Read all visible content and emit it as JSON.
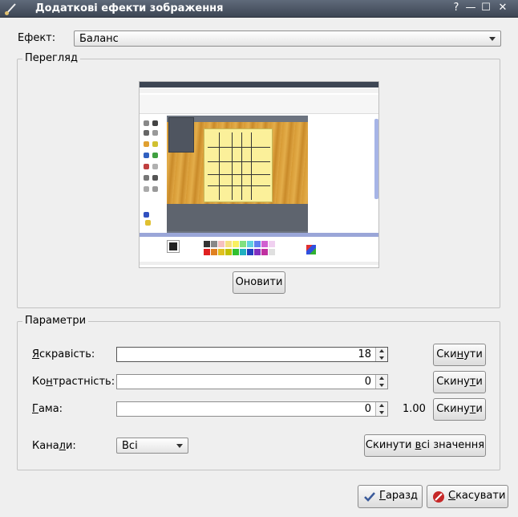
{
  "window": {
    "title": "Додаткові ефекти зображення",
    "buttons": {
      "help": "?",
      "minimize": "—",
      "maximize": "☐",
      "close": "✕"
    }
  },
  "effect": {
    "label": "Ефект:",
    "value": "Баланс"
  },
  "preview": {
    "group_title": "Перегляд",
    "update_button": "Оновити"
  },
  "params": {
    "group_title": "Параметри",
    "rows": [
      {
        "label_ul": "Я",
        "label_rest": "скравість:",
        "value": "18",
        "reset_pre": "Ски",
        "reset_ul": "н",
        "reset_post": "ути"
      },
      {
        "label_pre": "Ко",
        "label_ul": "н",
        "label_rest": "трастність:",
        "value": "0",
        "reset_pre": "Скину",
        "reset_ul": "т",
        "reset_post": "и"
      },
      {
        "label_ul": "Г",
        "label_rest": "ама:",
        "value": "0",
        "extra": "1.00",
        "reset_pre": "Скину",
        "reset_ul": "т",
        "reset_post": "и"
      }
    ],
    "channels": {
      "label_pre": "Кана",
      "label_ul": "л",
      "label_rest": "и:",
      "value": "Всі"
    },
    "reset_all": {
      "pre": "Скинути ",
      "ul": "в",
      "post": "сі значення"
    }
  },
  "footer": {
    "ok": {
      "ul": "Г",
      "post": "аразд"
    },
    "cancel": {
      "ul": "С",
      "post": "касувати"
    }
  },
  "colors": {
    "titlebar": "#3d4654",
    "dialog_bg": "#efefef"
  }
}
